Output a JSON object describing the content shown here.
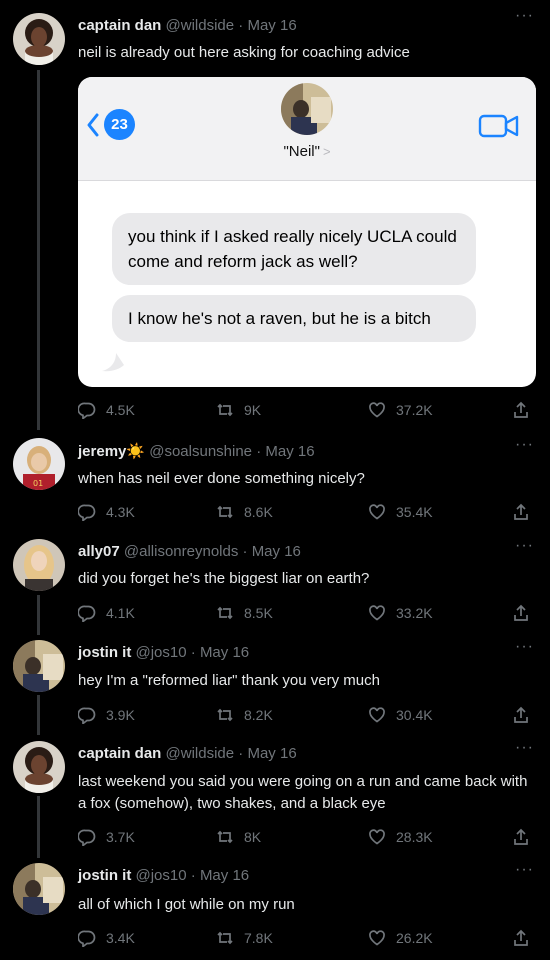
{
  "tweets": [
    {
      "name": "captain dan",
      "handle": "@wildside",
      "sep": "·",
      "date": "May 16",
      "text": "neil is already out here asking for coaching advice",
      "replies": "4.5K",
      "retweets": "9K",
      "likes": "37.2K",
      "more": "···"
    },
    {
      "name": "jeremy",
      "name_emoji": "☀️",
      "handle": "@soalsunshine",
      "sep": "·",
      "date": "May 16",
      "text": "when has neil ever done something nicely?",
      "replies": "4.3K",
      "retweets": "8.6K",
      "likes": "35.4K",
      "more": "···"
    },
    {
      "name": "ally07",
      "handle": "@allisonreynolds",
      "sep": "·",
      "date": "May 16",
      "text": "did you forget he's the biggest liar on earth?",
      "replies": "4.1K",
      "retweets": "8.5K",
      "likes": "33.2K",
      "more": "···"
    },
    {
      "name": "jostin it",
      "handle": "@jos10",
      "sep": "·",
      "date": "May 16",
      "text": "hey I'm a \"reformed liar\" thank you very much",
      "replies": "3.9K",
      "retweets": "8.2K",
      "likes": "30.4K",
      "more": "···"
    },
    {
      "name": "captain dan",
      "handle": "@wildside",
      "sep": "·",
      "date": "May 16",
      "text": "last weekend you said you were going on a run and came back with a fox (somehow), two shakes, and a black eye",
      "replies": "3.7K",
      "retweets": "8K",
      "likes": "28.3K",
      "more": "···"
    },
    {
      "name": "jostin it",
      "handle": "@jos10",
      "sep": "·",
      "date": "May 16",
      "text": "all of which I got while on my run",
      "replies": "3.4K",
      "retweets": "7.8K",
      "likes": "26.2K",
      "more": "···"
    }
  ],
  "imessage": {
    "unread_count": "23",
    "contact_name": "\"Neil\"",
    "contact_chevron": ">",
    "bubbles": [
      "you think if I asked really nicely UCLA could come and reform jack as well?",
      "I know he's not a raven, but he is a bitch"
    ]
  },
  "colors": {
    "background": "#000000",
    "text": "#e7e9ea",
    "muted": "#71767b",
    "imessage_blue": "#1b84ff",
    "bubble_gray": "#e9e9eb"
  },
  "icons": [
    "reply-icon",
    "retweet-icon",
    "like-icon",
    "share-icon",
    "more-icon",
    "video-call-icon",
    "back-chevron-icon"
  ]
}
